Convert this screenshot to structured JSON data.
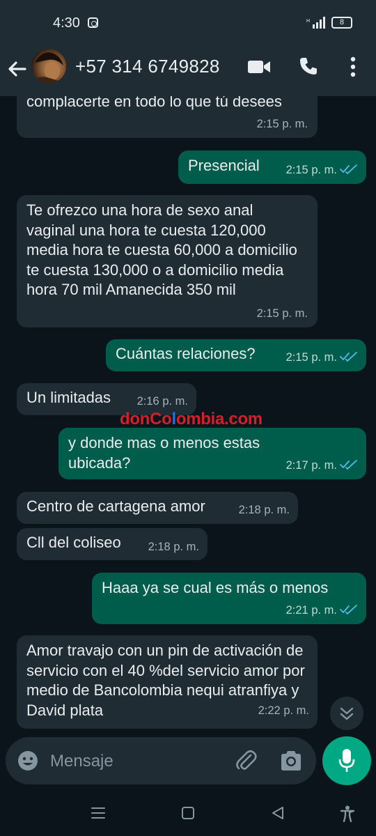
{
  "status_bar": {
    "time": "4:30",
    "battery": "8",
    "icons": [
      "instagram-icon",
      "signal-icon",
      "battery-icon"
    ]
  },
  "header": {
    "contact": "+57 314 6749828",
    "icons": [
      "back-arrow-icon",
      "video-call-icon",
      "phone-icon",
      "more-options-icon"
    ]
  },
  "messages": [
    {
      "dir": "in",
      "text": "complacerte en todo lo que tú desees",
      "time": "2:15 p. m."
    },
    {
      "dir": "out",
      "text": "Presencial",
      "time": "2:15 p. m.",
      "read": true
    },
    {
      "dir": "in",
      "text": "Te ofrezco una hora de sexo anal vaginal una hora te cuesta 120,000 media hora te cuesta 60,000 a domicilio te cuesta 130,000 o a domicilio media hora 70 mil Amanecida  350 mil",
      "time": "2:15 p. m."
    },
    {
      "dir": "out",
      "text": "Cuántas relaciones?",
      "time": "2:15 p. m.",
      "read": true
    },
    {
      "dir": "in",
      "text": "Un limitadas",
      "time": "2:16 p. m."
    },
    {
      "dir": "out",
      "text": "y donde mas o menos estas ubicada?",
      "time": "2:17 p. m.",
      "read": true
    },
    {
      "dir": "in",
      "text": "Centro de cartagena amor",
      "time": "2:18 p. m."
    },
    {
      "dir": "in",
      "text": "Cll del coliseo",
      "time": "2:18 p. m."
    },
    {
      "dir": "out",
      "text": "Haaa ya se cual es más o menos",
      "time": "2:21 p. m.",
      "read": true
    },
    {
      "dir": "in",
      "text": "Amor travajo con un pin de activación de servicio con el 40 %del servicio amor por medio de Bancolombia nequi atranfiya y David plata",
      "time": "2:22 p. m."
    }
  ],
  "watermark": {
    "prefix": "donCo",
    "accent": "l",
    "suffix": "ombia.com"
  },
  "composer": {
    "placeholder": "Mensaje",
    "icons": [
      "emoji-icon",
      "attach-icon",
      "camera-icon",
      "mic-icon"
    ]
  },
  "colors": {
    "header_bg": "#1f2c34",
    "chat_bg": "#0b141a",
    "incoming_bubble": "#202c33",
    "outgoing_bubble": "#005c4b",
    "accent": "#00a884",
    "read_ticks": "#53bdeb"
  }
}
